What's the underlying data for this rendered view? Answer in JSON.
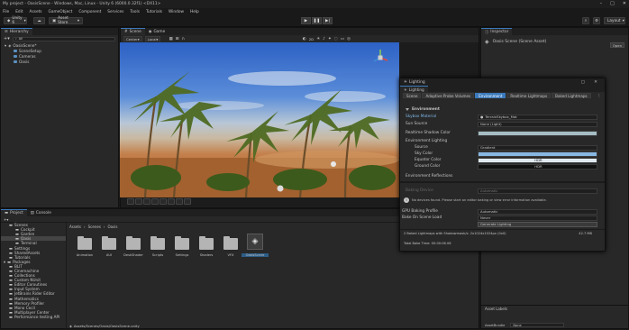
{
  "window": {
    "title": "My project - OasisScene - Windows, Mac, Linux - Unity 6 (6000.0.32f1) <DX11>"
  },
  "menu": [
    "File",
    "Edit",
    "Assets",
    "GameObject",
    "Component",
    "Services",
    "Tools",
    "Tutorials",
    "Window",
    "Help"
  ],
  "toolbar": {
    "account": "Unity 6",
    "asset_store": "Asset Store",
    "layout": "Layout"
  },
  "hierarchy": {
    "title": "Hierarchy",
    "search_label": "All",
    "items": [
      {
        "label": "OasisScene*",
        "depth": 0
      },
      {
        "label": "SceneSetup",
        "depth": 1
      },
      {
        "label": "Cameras",
        "depth": 1
      },
      {
        "label": "Oasis",
        "depth": 1
      }
    ]
  },
  "scene_view": {
    "tab_scene": "Scene",
    "tab_game": "Game",
    "pivot": "Center",
    "space": "Local",
    "mode": "2D"
  },
  "inspector": {
    "title": "Inspector",
    "asset_name": "Oasis Scene (Scene Asset)",
    "open_label": "Open",
    "asset_labels": "Asset Labels",
    "asset_bundle": "AssetBundle",
    "bundle_value": "None"
  },
  "lighting": {
    "title": "Lighting",
    "tab_label": "Lighting",
    "tabs": [
      "Scene",
      "Adaptive Probe Volumes",
      "Environment",
      "Realtime Lightmaps",
      "Baked Lightmaps"
    ],
    "active_tab": "Environment",
    "section_environment": "Environment",
    "skybox_label": "Skybox Material",
    "skybox_value": "TerrainSkybox_Mat",
    "sun_label": "Sun Source",
    "sun_value": "None (Light)",
    "shadow_label": "Realtime Shadow Color",
    "env_lighting": "Environment Lighting",
    "source_label": "Source",
    "source_value": "Gradient",
    "sky_label": "Sky Color",
    "equator_label": "Equator Color",
    "equator_tag": "HDR",
    "ground_label": "Ground Color",
    "ground_tag": "HDR",
    "reflections": "Environment Reflections",
    "baking_device_label": "Baking Device",
    "baking_device_value": "Automatic",
    "warning": "No devices found. Please start an editor baking or view error information available.",
    "gpu_profile_label": "GPU Baking Profile",
    "gpu_profile_value": "Automatic",
    "bake_load_label": "Bake On Scene Load",
    "bake_load_value": "Never",
    "generate_label": "Generate Lighting",
    "stats": "2 Baked Lightmaps with Shadowmask/s: 2x1024x1024px (0x0)",
    "stats_size": "42.7 MB",
    "total_time": "Total Bake Time: 00:00:06.06"
  },
  "project": {
    "tab_project": "Project",
    "tab_console": "Console",
    "breadcrumb": [
      "Assets",
      "Scenes",
      "Oasis"
    ],
    "tree": [
      {
        "label": "Scenes",
        "depth": 1
      },
      {
        "label": "Cockpit",
        "depth": 2
      },
      {
        "label": "Garden",
        "depth": 2
      },
      {
        "label": "Oasis",
        "depth": 2
      },
      {
        "label": "Terminal",
        "depth": 2
      },
      {
        "label": "Settings",
        "depth": 1
      },
      {
        "label": "SharedAssets",
        "depth": 1
      },
      {
        "label": "Tutorials",
        "depth": 1
      },
      {
        "label": "Packages",
        "depth": 0
      },
      {
        "label": "BLIT",
        "depth": 1
      },
      {
        "label": "Cinemachine",
        "depth": 1
      },
      {
        "label": "Collections",
        "depth": 1
      },
      {
        "label": "Custom NUnit",
        "depth": 1
      },
      {
        "label": "Editor Coroutines",
        "depth": 1
      },
      {
        "label": "Input System",
        "depth": 1
      },
      {
        "label": "JetBrains Rider Editor",
        "depth": 1
      },
      {
        "label": "Mathematics",
        "depth": 1
      },
      {
        "label": "Memory Profiler",
        "depth": 1
      },
      {
        "label": "Mono Cecil",
        "depth": 1
      },
      {
        "label": "Multiplayer Center",
        "depth": 1
      },
      {
        "label": "Performance testing API",
        "depth": 1
      }
    ],
    "files": [
      "Animation",
      "AUI",
      "DeskShader",
      "Scripts",
      "Settings",
      "Shaders",
      "VFX",
      "OasisScene"
    ],
    "status_path": "Assets/Scenes/Oasis/OasisScene.unity"
  }
}
